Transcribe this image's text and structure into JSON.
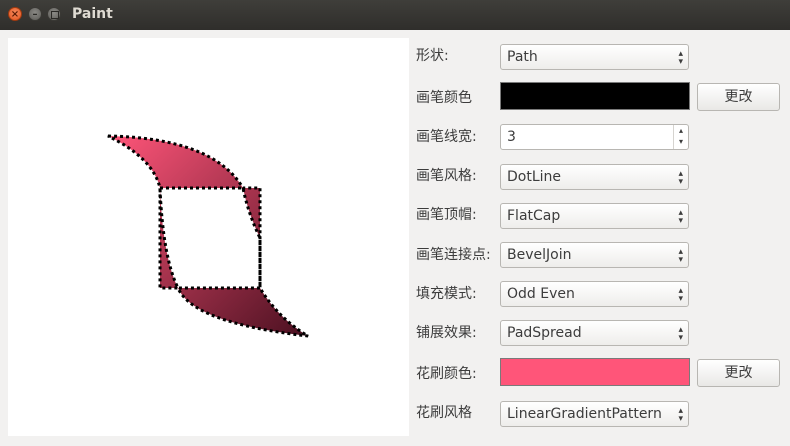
{
  "window": {
    "title": "Paint",
    "close_glyph": "×",
    "minimize_glyph": "–"
  },
  "controls": {
    "shape": {
      "label": "形状:",
      "value": "Path"
    },
    "pen_color": {
      "label": "画笔颜色",
      "color": "#000000",
      "button": "更改"
    },
    "pen_width": {
      "label": "画笔线宽:",
      "value": "3"
    },
    "pen_style": {
      "label": "画笔风格:",
      "value": "DotLine"
    },
    "pen_cap": {
      "label": "画笔顶帽:",
      "value": "FlatCap"
    },
    "pen_join": {
      "label": "画笔连接点:",
      "value": "BevelJoin"
    },
    "fill_mode": {
      "label": "填充模式:",
      "value": "Odd Even"
    },
    "spread": {
      "label": "铺展效果:",
      "value": "PadSpread"
    },
    "brush_color": {
      "label": "花刷颜色:",
      "color": "#ff5579",
      "button": "更改"
    },
    "brush_style": {
      "label": "花刷风格",
      "value": "LinearGradientPattern"
    }
  },
  "icons": {
    "combo_arrow": "up-down-arrows-icon",
    "spin_arrow": "spin-up-down-icon"
  },
  "colors": {
    "gradient_start": "#ff5579",
    "gradient_end": "#4a1020",
    "outline": "#000000"
  }
}
